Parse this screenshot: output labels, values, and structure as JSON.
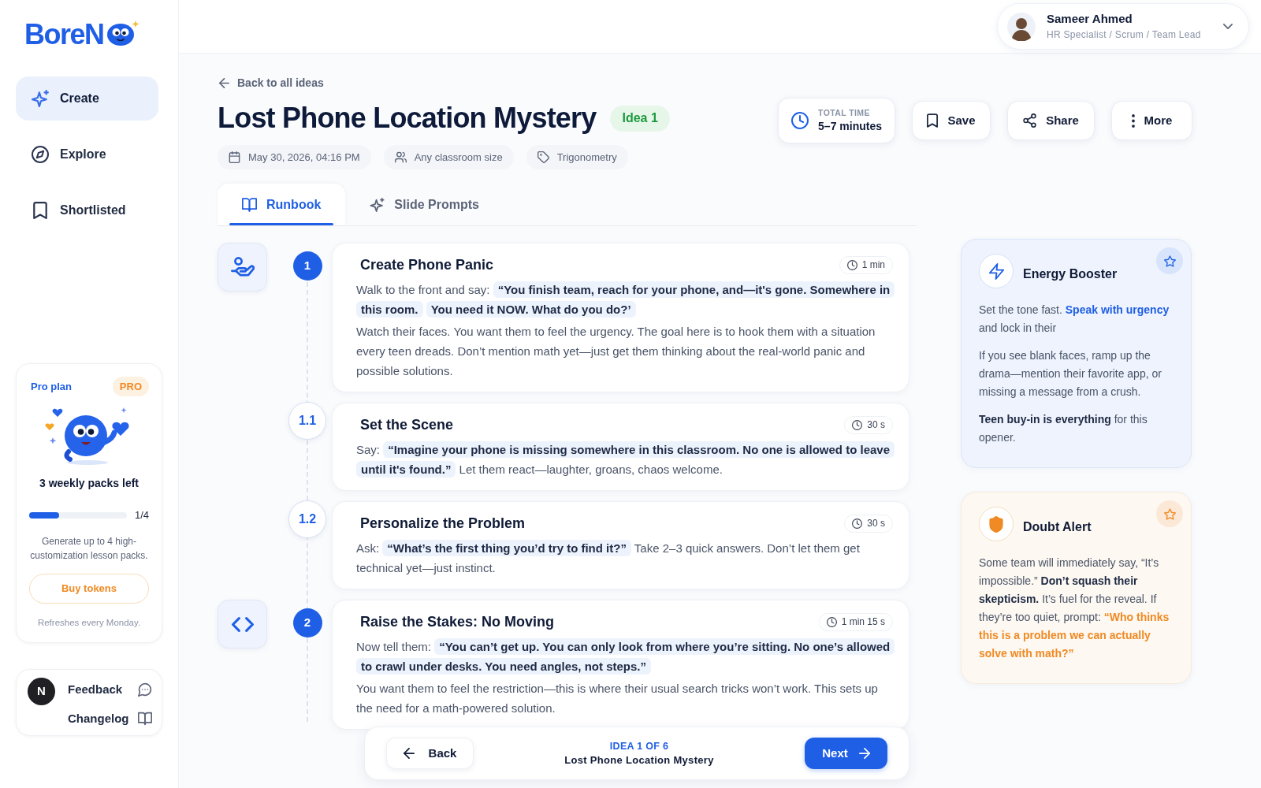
{
  "logo": {
    "wordmark": "BoreN"
  },
  "sidebar": {
    "nav": [
      {
        "label": "Create",
        "selected": true
      },
      {
        "label": "Explore",
        "selected": false
      },
      {
        "label": "Shortlisted",
        "selected": false
      }
    ],
    "plan_card": {
      "title": "Pro plan",
      "badge": "PRO",
      "packs_left": "3 weekly packs left",
      "progress": {
        "level": 0.31,
        "reading": "1/4"
      },
      "description": "Generate up to 4 high-customization lesson packs.",
      "button": "Buy tokens",
      "note": "Refreshes every Monday."
    },
    "footer": {
      "avatar_initial": "N",
      "links": [
        {
          "label": "Feedback"
        },
        {
          "label": "Changelog"
        }
      ]
    }
  },
  "user_menu": {
    "name": "Sameer Ahmed",
    "role": "HR Specialist / Scrum / Team Lead"
  },
  "header": {
    "back_link": "Back to all ideas",
    "title": "Lost Phone Location Mystery",
    "badge": "Idea 1",
    "meta": [
      "May 30, 2026, 04:16 PM",
      "Any classroom size",
      "Trigonometry"
    ],
    "total_time": {
      "label": "TOTAL TIME",
      "value": "5–7 minutes"
    },
    "actions": [
      "Save",
      "Share",
      "More"
    ]
  },
  "tabs": [
    {
      "label": "Runbook",
      "selected": true
    },
    {
      "label": "Slide Prompts",
      "selected": false
    }
  ],
  "steps": [
    {
      "kind": "main",
      "number": "1",
      "title": "Create Phone Panic",
      "time": "1 min",
      "paragraphs": [
        [
          {
            "kind": "text",
            "text": "Walk to the front and say:"
          },
          {
            "kind": "quote",
            "text": "“You finish team, reach for your phone, and—it's gone. Somewhere in this room."
          },
          {
            "kind": "quote",
            "text": "You need it NOW. What do you do?’"
          }
        ],
        [
          {
            "kind": "text",
            "text": "Watch their faces. You want them to feel the urgency. The goal here is to hook them with a situation every teen dreads. Don’t mention math yet—just get them thinking about the real-world panic and possible solutions."
          }
        ]
      ]
    },
    {
      "kind": "sub",
      "number": "1.1",
      "title": "Set the Scene",
      "time": "30 s",
      "paragraphs": [
        [
          {
            "kind": "text",
            "text": "Say:"
          },
          {
            "kind": "quote",
            "text": "“Imagine your phone is missing somewhere in this classroom. No one is allowed to leave until it's found.”"
          },
          {
            "kind": "text",
            "text": "Let them react—laughter, groans, chaos welcome."
          }
        ]
      ]
    },
    {
      "kind": "sub",
      "number": "1.2",
      "title": "Personalize the Problem",
      "time": "30 s",
      "paragraphs": [
        [
          {
            "kind": "text",
            "text": "Ask:"
          },
          {
            "kind": "quote",
            "text": "“What’s the first thing you’d try to find it?”"
          },
          {
            "kind": "text",
            "text": "Take 2–3 quick answers. Don’t let them get technical yet—just instinct."
          }
        ]
      ]
    },
    {
      "kind": "main",
      "number": "2",
      "title": "Raise the Stakes: No Moving",
      "time": "1 min 15 s",
      "paragraphs": [
        [
          {
            "kind": "text",
            "text": "Now tell them:"
          },
          {
            "kind": "quote",
            "text": "“You can’t get up. You can only look from where you’re sitting. No one’s allowed to crawl under desks. You need angles, not steps.”"
          }
        ],
        [
          {
            "kind": "text",
            "text": "You want them to feel the restriction—this is where their usual search tricks won’t work. This sets up the need for a math-powered solution."
          }
        ]
      ]
    }
  ],
  "tips": [
    {
      "kind": "energy",
      "title": "Energy Booster",
      "starred": false,
      "paragraphs": [
        [
          {
            "kind": "text",
            "text": "Set the tone fast."
          },
          {
            "kind": "accent",
            "text": "Speak with urgency"
          },
          {
            "kind": "text",
            "text": "and lock in their"
          }
        ],
        [
          {
            "kind": "text",
            "text": "If you see blank faces, ramp up the drama—mention their favorite app, or missing a message from a crush."
          }
        ],
        [
          {
            "kind": "strong",
            "text": "Teen buy-in is everything"
          },
          {
            "kind": "text",
            "text": "for this opener."
          }
        ]
      ]
    },
    {
      "kind": "doubt",
      "title": "Doubt Alert",
      "starred": false,
      "paragraphs": [
        [
          {
            "kind": "text",
            "text": "Some team will immediately say, “It’s impossible.”"
          },
          {
            "kind": "strong",
            "text": "Don’t squash their skepticism."
          },
          {
            "kind": "text",
            "text": "It’s fuel for the reveal. If they’re too quiet, prompt:"
          },
          {
            "kind": "accent",
            "text": "“Who thinks this is a problem we can actually solve with math?”"
          }
        ]
      ]
    }
  ],
  "pager": {
    "back": "Back",
    "position": "IDEA 1 OF 6",
    "title": "Lost Phone Location Mystery",
    "next": "Next"
  }
}
